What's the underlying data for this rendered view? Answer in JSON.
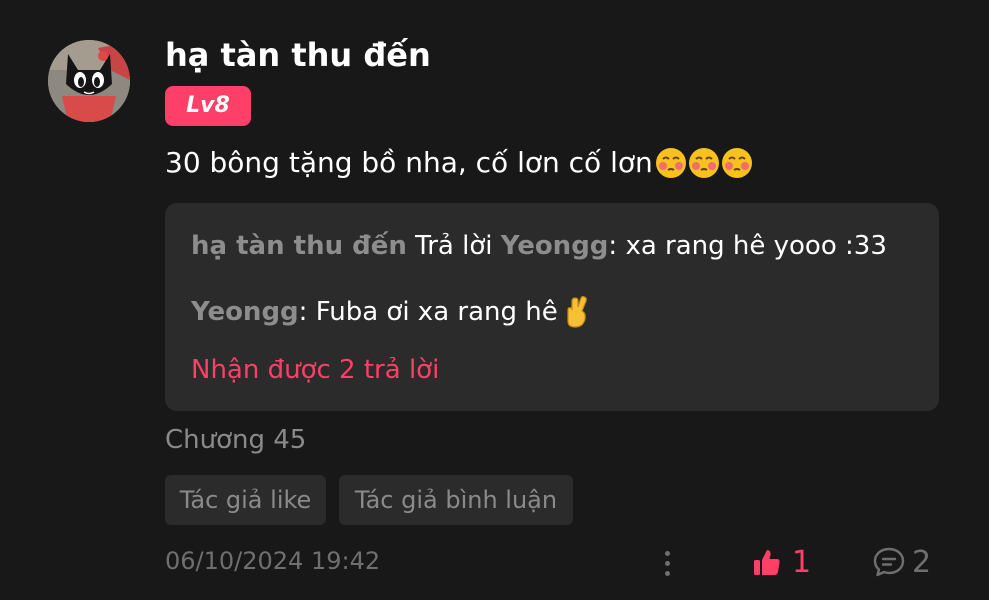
{
  "comment": {
    "username": "hạ tàn thu đến",
    "level": "Lv8",
    "text": "30 bông tặng bồ nha, cố lơn cố lơn",
    "emojis": [
      "blushing-face-emoji",
      "blushing-face-emoji",
      "blushing-face-emoji"
    ],
    "chapter": "Chương 45",
    "tags": [
      "Tác giả like",
      "Tác giả bình luận"
    ],
    "timestamp": "06/10/2024 19:42",
    "like_count": "1",
    "reply_count": "2"
  },
  "replies": [
    {
      "author": "hạ tàn thu đến",
      "action": " Trả lời ",
      "target": "Yeongg",
      "text": ": xa rang hê yooo :33"
    },
    {
      "author": "Yeongg",
      "text": ": Fuba ơi xa rang hê",
      "emoji": "crossed-fingers-emoji"
    }
  ],
  "replies_more_label": "Nhận được 2 trả lời",
  "icons": {
    "avatar": "black-cat-avatar",
    "more": "vertical-dots-icon",
    "like": "thumbs-up-icon",
    "reply": "speech-bubble-icon"
  },
  "colors": {
    "background": "#181818",
    "accent": "#fe3f67",
    "panel": "#2b2b2b",
    "muted": "#8a8a8a"
  }
}
